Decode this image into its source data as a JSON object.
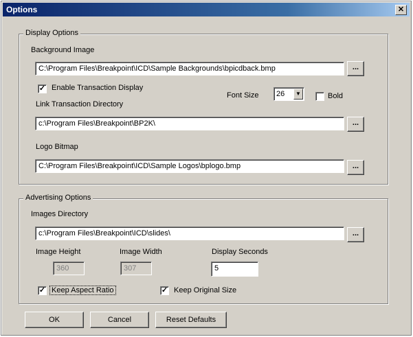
{
  "window": {
    "title": "Options",
    "close_glyph": "✕"
  },
  "display_options": {
    "legend": "Display Options",
    "background_image": {
      "label": "Background Image",
      "value": "C:\\Program Files\\Breakpoint\\ICD\\Sample Backgrounds\\bpicdback.bmp"
    },
    "enable_transaction": {
      "label": "Enable Transaction Display",
      "checked": true
    },
    "font_size": {
      "label": "Font Size",
      "value": "26"
    },
    "bold": {
      "label": "Bold",
      "checked": false
    },
    "link_directory": {
      "label": "Link Transaction Directory",
      "value": "c:\\Program Files\\Breakpoint\\BP2K\\"
    },
    "logo_bitmap": {
      "label": "Logo Bitmap",
      "value": "C:\\Program Files\\Breakpoint\\ICD\\Sample Logos\\bplogo.bmp"
    }
  },
  "advertising_options": {
    "legend": "Advertising Options",
    "images_directory": {
      "label": "Images Directory",
      "value": "c:\\Program Files\\Breakpoint\\ICD\\slides\\"
    },
    "image_height": {
      "label": "Image Height",
      "value": "360"
    },
    "image_width": {
      "label": "Image Width",
      "value": "307"
    },
    "display_seconds": {
      "label": "Display Seconds",
      "value": "5"
    },
    "keep_aspect": {
      "label": "Keep Aspect Ratio",
      "checked": true
    },
    "keep_original": {
      "label": "Keep Original Size",
      "checked": true
    }
  },
  "browse_label": "...",
  "check_glyph": "✓",
  "dropdown_glyph": "▼",
  "buttons": {
    "ok": "OK",
    "cancel": "Cancel",
    "reset": "Reset Defaults"
  }
}
